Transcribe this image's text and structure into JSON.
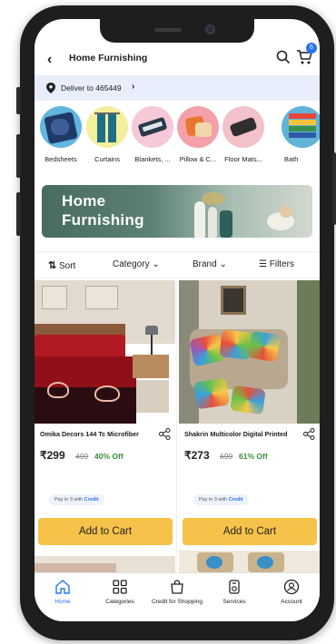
{
  "header": {
    "title": "Home Furnishing",
    "cart_count": "6"
  },
  "delivery": {
    "text": "Deliver to 465449"
  },
  "categories": [
    {
      "label": "Bedsheets"
    },
    {
      "label": "Curtains"
    },
    {
      "label": "Blankets, ..."
    },
    {
      "label": "Pillow & C..."
    },
    {
      "label": "Floor Mats..."
    },
    {
      "label": "Bath"
    }
  ],
  "banner": {
    "line1": "Home",
    "line2": "Furnishing"
  },
  "filters": {
    "sort": "Sort",
    "category": "Category",
    "brand": "Brand",
    "filters": "Filters"
  },
  "products": [
    {
      "name": "Omika Decors 144 Tc Microfiber",
      "price": "₹299",
      "mrp": "499",
      "off": "40% Off",
      "pay_prefix": "Pay in 3 with",
      "pay_brand": "Credit",
      "cta": "Add to Cart"
    },
    {
      "name": "Shakrin Multicolor Digital Printed",
      "price": "₹273",
      "mrp": "699",
      "off": "61% Off",
      "pay_prefix": "Pay in 3 with",
      "pay_brand": "Credit",
      "cta": "Add to Cart"
    }
  ],
  "nav": [
    {
      "label": "Home",
      "icon": "home-icon",
      "active": true
    },
    {
      "label": "Categories",
      "icon": "grid-icon"
    },
    {
      "label": "Credit for Shopping",
      "icon": "shopping-bag-icon"
    },
    {
      "label": "Services",
      "icon": "services-icon"
    },
    {
      "label": "Account",
      "icon": "account-icon"
    }
  ],
  "colors": {
    "accent": "#2874f0",
    "cta": "#f7c24a",
    "discount": "#388e3c",
    "delivery_bg": "#e8eefb"
  }
}
